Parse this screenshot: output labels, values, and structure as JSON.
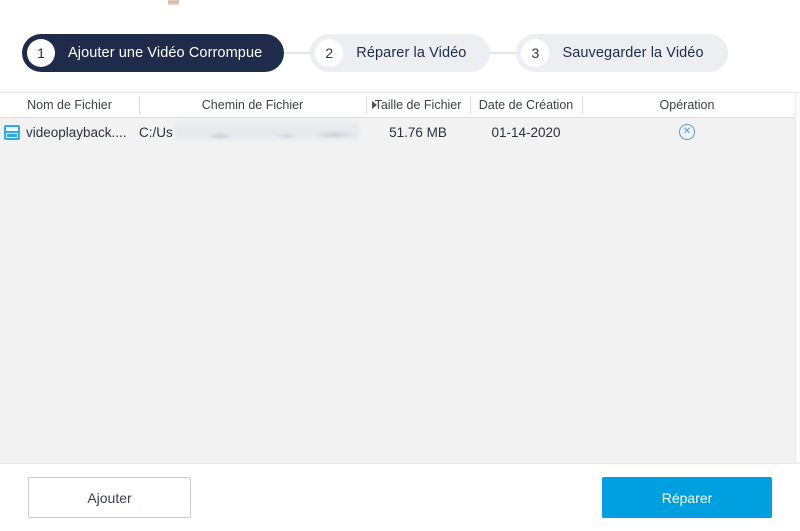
{
  "stepper": {
    "steps": [
      {
        "number": "1",
        "label": "Ajouter une Vidéo Corrompue",
        "state": "active"
      },
      {
        "number": "2",
        "label": "Réparer la Vidéo",
        "state": "inactive"
      },
      {
        "number": "3",
        "label": "Sauvegarder la Vidéo",
        "state": "inactive"
      }
    ]
  },
  "table": {
    "columns": {
      "name": "Nom de Fichier",
      "path": "Chemin de Fichier",
      "size": "Taille de Fichier",
      "date": "Date de Création",
      "operation": "Opération"
    },
    "rows": [
      {
        "icon": "video-file-icon",
        "name": "videoplayback....",
        "path_prefix": "C:/Us",
        "path_redacted": true,
        "size": "51.76  MB",
        "date": "01-14-2020",
        "delete_glyph": "✕"
      }
    ]
  },
  "footer": {
    "add_label": "Ajouter",
    "repair_label": "Réparer"
  },
  "colors": {
    "step_active_bg": "#1e2b4b",
    "step_inactive_bg": "#eceef1",
    "primary_button": "#00a0e0",
    "table_body_bg": "#f2f2f2",
    "file_icon": "#30a9e8",
    "delete_icon": "#5b9bd5"
  }
}
